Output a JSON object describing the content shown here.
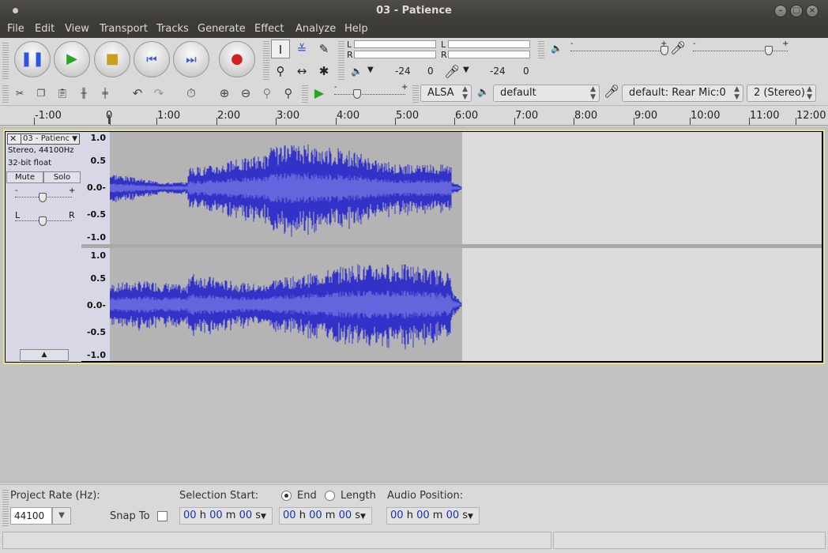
{
  "window": {
    "title": "03 - Patience"
  },
  "menu": [
    "File",
    "Edit",
    "View",
    "Transport",
    "Tracks",
    "Generate",
    "Effect",
    "Analyze",
    "Help"
  ],
  "meter": {
    "play_l": "L",
    "play_r": "R",
    "rec_l": "L",
    "rec_r": "R",
    "play_db": "-24",
    "play_zero": "0",
    "rec_db": "-24",
    "rec_zero": "0"
  },
  "sliders": {
    "minus": "-",
    "plus": "+"
  },
  "device": {
    "host": "ALSA",
    "playback": "default",
    "recording": "default: Rear Mic:0",
    "channels": "2 (Stereo)"
  },
  "ruler": {
    "labels": [
      "-1:00",
      "0",
      "1:00",
      "2:00",
      "3:00",
      "4:00",
      "5:00",
      "6:00",
      "7:00",
      "8:00",
      "9:00",
      "10:00",
      "11:00",
      "12:00"
    ]
  },
  "track": {
    "name": "03 - Patienc",
    "format": "Stereo, 44100Hz",
    "bitdepth": "32-bit float",
    "mute": "Mute",
    "solo": "Solo",
    "gain_minus": "-",
    "gain_plus": "+",
    "pan_left": "L",
    "pan_right": "R",
    "y_labels": [
      "1.0",
      "0.5",
      "0.0-",
      "-0.5",
      "-1.0"
    ]
  },
  "selection": {
    "project_rate_label": "Project Rate (Hz):",
    "project_rate": "44100",
    "snap_label": "Snap To",
    "selection_start_label": "Selection Start:",
    "end_label": "End",
    "length_label": "Length",
    "audio_position_label": "Audio Position:",
    "time": {
      "hh": "00",
      "h": "h",
      "mm": "00",
      "m": "m",
      "ss": "00",
      "s": "s"
    }
  },
  "colors": {
    "waveform": "#3232c8",
    "waveform_rms": "#6464dc",
    "track_border": "#e6e38a"
  }
}
